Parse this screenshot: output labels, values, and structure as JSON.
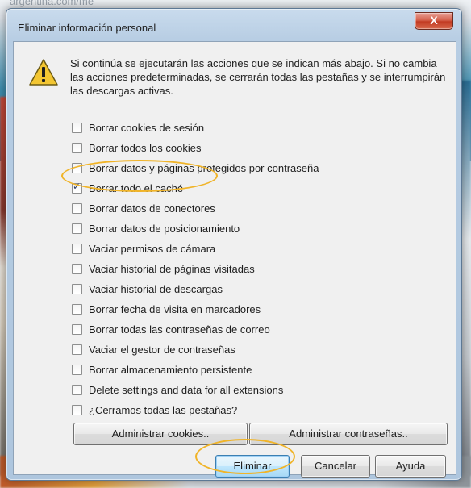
{
  "background": {
    "partial_text": "argentina.com/me"
  },
  "dialog": {
    "title": "Eliminar información personal",
    "close_label": "X",
    "warning_icon": "warning-triangle-icon",
    "message": "Si continúa se ejecutarán las acciones que se indican más abajo. Si no cambia las acciones predeterminadas, se cerrarán todas las pestañas y se interrumpirán las descargas activas.",
    "options": [
      {
        "label": "Borrar cookies de sesión",
        "checked": false
      },
      {
        "label": "Borrar todos los cookies",
        "checked": false
      },
      {
        "label": "Borrar datos y páginas protegidos por contraseña",
        "checked": false
      },
      {
        "label": "Borrar todo el caché",
        "checked": true
      },
      {
        "label": "Borrar datos de conectores",
        "checked": false
      },
      {
        "label": "Borrar datos de posicionamiento",
        "checked": false
      },
      {
        "label": "Vaciar permisos de cámara",
        "checked": false
      },
      {
        "label": "Vaciar historial de páginas visitadas",
        "checked": false
      },
      {
        "label": "Vaciar historial de descargas",
        "checked": false
      },
      {
        "label": "Borrar fecha de visita en marcadores",
        "checked": false
      },
      {
        "label": "Borrar todas las contraseñas de correo",
        "checked": false
      },
      {
        "label": "Vaciar el gestor de contraseñas",
        "checked": false
      },
      {
        "label": "Borrar almacenamiento persistente",
        "checked": false
      },
      {
        "label": "Delete settings and data for all extensions",
        "checked": false
      },
      {
        "label": "¿Cerramos todas las pestañas?",
        "checked": false
      }
    ],
    "buttons": {
      "manage_cookies": "Administrar cookies..",
      "manage_passwords": "Administrar contraseñas..",
      "delete": "Eliminar",
      "cancel": "Cancelar",
      "help": "Ayuda"
    },
    "accent_color": "#f0b429"
  }
}
